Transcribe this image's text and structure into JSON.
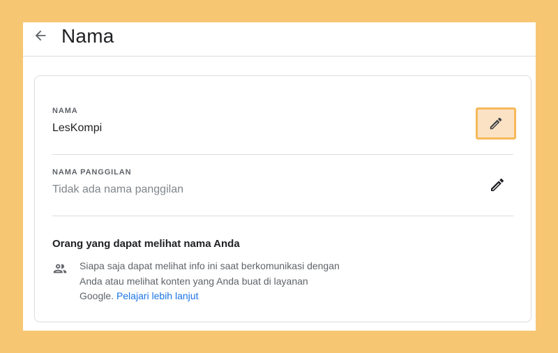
{
  "header": {
    "back_icon": "arrow-back-icon",
    "title": "Nama"
  },
  "fields": {
    "name": {
      "label": "NAMA",
      "value": "LesKompi",
      "edit_icon": "pencil-icon",
      "highlighted": true
    },
    "nickname": {
      "label": "NAMA PANGGILAN",
      "value": "Tidak ada nama panggilan",
      "edit_icon": "pencil-icon"
    }
  },
  "visibility": {
    "title": "Orang yang dapat melihat nama Anda",
    "icon": "people-icon",
    "text": "Siapa saja dapat melihat info ini saat berkomunikasi dengan Anda atau melihat konten yang Anda buat di layanan Google.",
    "link_text": "Pelajari lebih lanjut"
  },
  "colors": {
    "frame": "#F7C673",
    "highlight_fill": "#FCE2C4",
    "highlight_border": "#F5B95A",
    "link": "#1a73e8"
  }
}
